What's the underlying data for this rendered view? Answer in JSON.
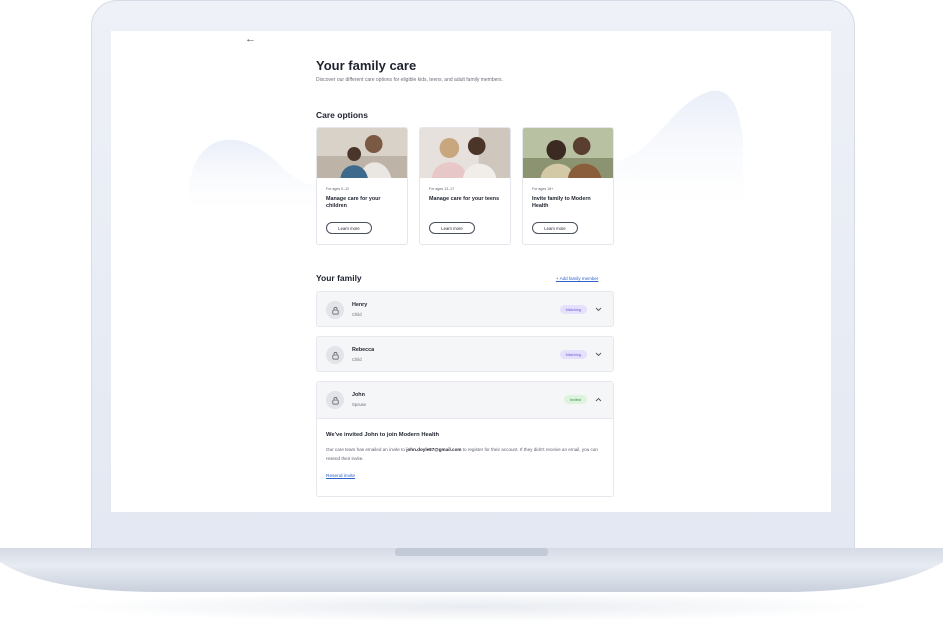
{
  "page": {
    "title": "Your family care",
    "subtitle": "Discover our different care options for eligible kids, teens, and adult family members."
  },
  "care_options": {
    "heading": "Care options",
    "cards": [
      {
        "age": "For ages 0–12",
        "title": "Manage care for your children",
        "button": "Learn more"
      },
      {
        "age": "For ages 13–17",
        "title": "Manage care for your teens",
        "button": "Learn more"
      },
      {
        "age": "For ages 18+",
        "title": "Invite family to Modern Health",
        "button": "Learn more"
      }
    ]
  },
  "family": {
    "heading": "Your family",
    "add_link": "+ Add family member",
    "members": [
      {
        "name": "Henry",
        "role": "Child",
        "status": "Matching"
      },
      {
        "name": "Rebecca",
        "role": "Child",
        "status": "Matching"
      },
      {
        "name": "John",
        "role": "Spouse",
        "status": "Invited"
      }
    ],
    "invite": {
      "title": "We've invited John to join Modern Health",
      "body_prefix": "Our care team has emailed an invite to ",
      "email": "john.doyle87@gmail.com",
      "body_suffix": " to register for their account. If they didn't receive an email, you can resend their invite.",
      "resend": "Resend invite"
    }
  },
  "colors": {
    "matching_bg": "#e6e1fb",
    "matching_text": "#6f55d6",
    "invited_bg": "#dcf3dd",
    "invited_text": "#3e8e47",
    "link": "#2d63c8"
  }
}
